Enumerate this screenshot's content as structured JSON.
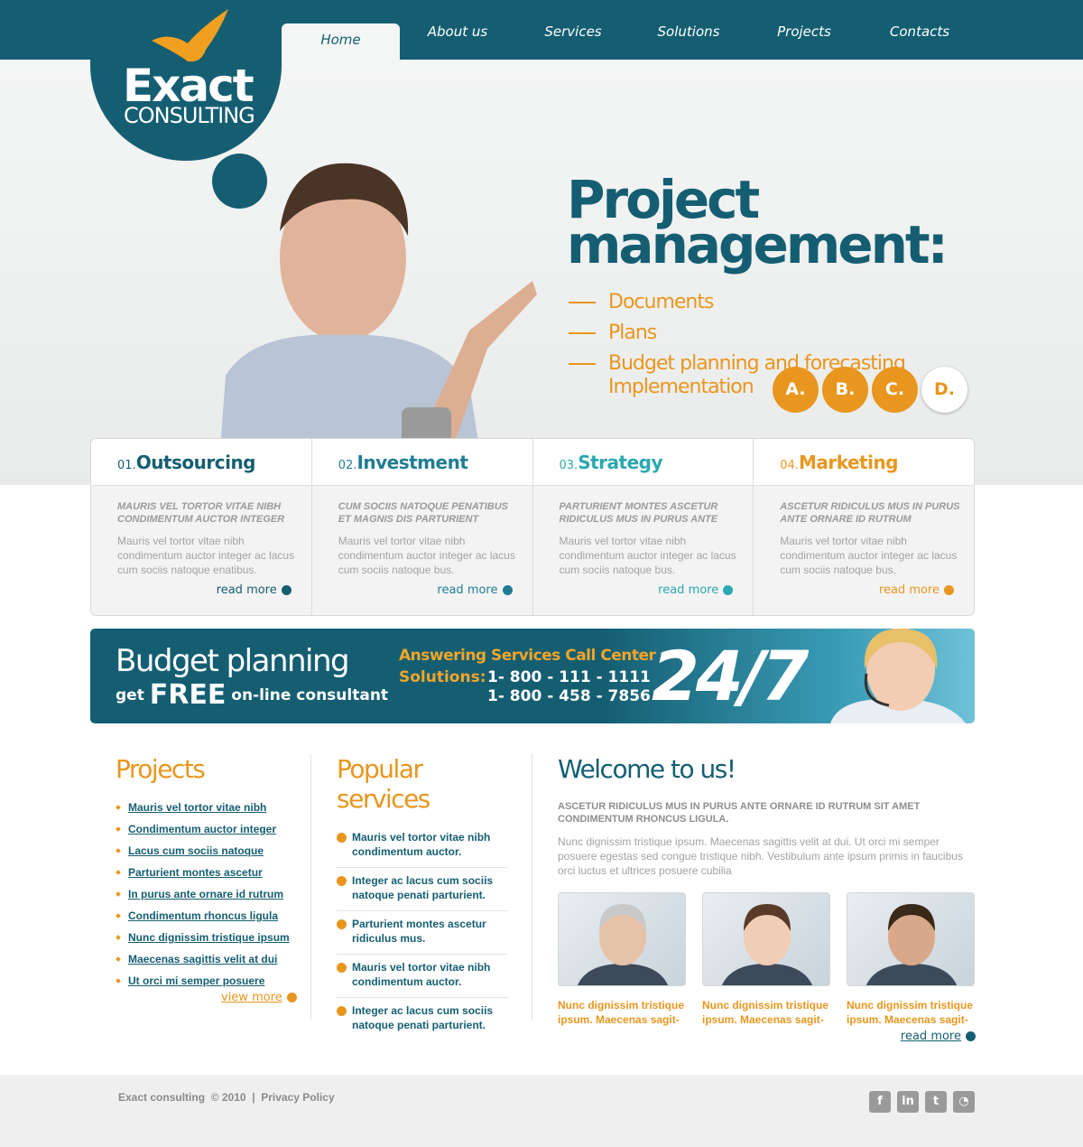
{
  "colors": {
    "brand": "#155e72",
    "accent": "#e8961e",
    "teal": "#2aa8b0"
  },
  "logo": {
    "line1": "Exact",
    "line2": "CONSULTING"
  },
  "nav": [
    {
      "label": "Home",
      "active": true
    },
    {
      "label": "About us"
    },
    {
      "label": "Services"
    },
    {
      "label": "Solutions"
    },
    {
      "label": "Projects"
    },
    {
      "label": "Contacts"
    }
  ],
  "hero": {
    "title_line1": "Project",
    "title_line2": "management:",
    "items": [
      "Documents",
      "Plans",
      "Budget planning and forecasting"
    ],
    "item_cont": "Implementation",
    "letters": [
      "A.",
      "B.",
      "C.",
      "D."
    ]
  },
  "cards": [
    {
      "num": "01.",
      "title": "Outsourcing",
      "sub": "MAURIS VEL TORTOR VITAE NIBH CONDIMENTUM AUCTOR INTEGER",
      "text": "Mauris vel tortor vitae nibh condimentum auctor integer ac lacus cum sociis natoque enatibus.",
      "link": "read more",
      "color": "#155e72"
    },
    {
      "num": "02.",
      "title": "Investment",
      "sub": "CUM SOCIIS NATOQUE PENATIBUS ET MAGNIS DIS PARTURIENT",
      "text": "Mauris vel tortor vitae nibh condimentum auctor integer ac lacus cum sociis natoque bus.",
      "link": "read more",
      "color": "#1f7d92"
    },
    {
      "num": "03.",
      "title": "Strategy",
      "sub": "PARTURIENT MONTES ASCETUR RIDICULUS MUS IN PURUS ANTE",
      "text": "Mauris vel tortor vitae nibh condimentum auctor integer ac lacus cum sociis natoque bus.",
      "link": "read more",
      "color": "#2aa8b0"
    },
    {
      "num": "04.",
      "title": "Marketing",
      "sub": "ASCETUR RIDICULUS MUS IN PURUS ANTE ORNARE ID RUTRUM",
      "text": "Mauris vel tortor vitae nibh condimentum auctor integer ac lacus cum sociis natoque bus.",
      "link": "read more",
      "color": "#e8961e"
    }
  ],
  "banner": {
    "title": "Budget planning",
    "get": "get",
    "free": "FREE",
    "online": "on-line consultant",
    "answering": "Answering Services Call Center",
    "solutions": "Solutions:",
    "phone1": "1- 800 - 111 - 1111",
    "phone2": "1- 800 - 458 - 7856",
    "hours": "24/7"
  },
  "projects": {
    "title": "Projects",
    "items": [
      "Mauris vel tortor vitae nibh",
      "Condimentum auctor integer",
      "Lacus cum sociis natoque",
      "Parturient montes ascetur",
      "In purus ante ornare id rutrum",
      "Condimentum rhoncus ligula",
      "Nunc dignissim tristique ipsum",
      "Maecenas sagittis velit at dui",
      "Ut orci mi semper posuere"
    ],
    "link": "view more"
  },
  "services": {
    "title": "Popular services",
    "items": [
      "Mauris vel tortor vitae nibh condimentum auctor.",
      "Integer ac lacus cum sociis natoque penati parturient.",
      "Parturient montes ascetur ridiculus mus.",
      "Mauris vel tortor vitae nibh condimentum auctor.",
      "Integer ac lacus cum sociis natoque penati parturient."
    ]
  },
  "welcome": {
    "title": "Welcome to us!",
    "sub": "ASCETUR RIDICULUS MUS IN PURUS ANTE ORNARE ID RUTRUM SIT AMET CONDIMENTUM RHONCUS LIGULA.",
    "text": "Nunc dignissim tristique ipsum. Maecenas sagittis velit at dui. Ut orci mi semper posuere egestas sed congue tristique nibh. Vestibulum ante ipsum primis in faucibus orci luctus et ultrices posuere cubilia",
    "captions": [
      "Nunc dignissim tristique ipsum. Maecenas sagit-",
      "Nunc dignissim tristique ipsum. Maecenas sagit-",
      "Nunc dignissim tristique ipsum. Maecenas sagit-"
    ],
    "link": "read more"
  },
  "footer": {
    "text": "Exact consulting  © 2010  |  Privacy Policy",
    "social": [
      {
        "icon": "facebook-icon",
        "glyph": "f"
      },
      {
        "icon": "linkedin-icon",
        "glyph": "in"
      },
      {
        "icon": "twitter-icon",
        "glyph": "t"
      },
      {
        "icon": "chat-icon",
        "glyph": "◔"
      }
    ]
  }
}
